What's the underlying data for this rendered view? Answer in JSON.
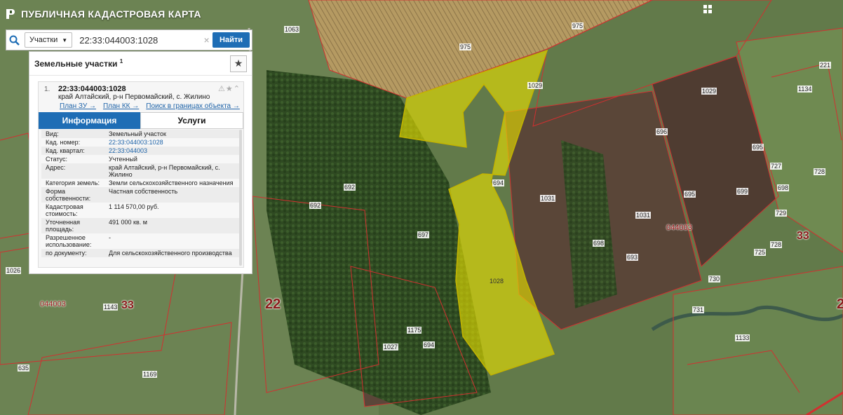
{
  "app": {
    "title": "ПУБЛИЧНАЯ КАДАСТРОВАЯ КАРТА"
  },
  "search": {
    "type_label": "Участки",
    "query": "22:33:044003:1028",
    "button_label": "Найти"
  },
  "results": {
    "title": "Земельные участки",
    "count": "1",
    "item": {
      "index": "1.",
      "cadastral_number": "22:33:044003:1028",
      "address": "край Алтайский, р-н Первомайский, с. Жилино",
      "links": [
        "План ЗУ →",
        "План КК →",
        "Поиск в границах объекта →"
      ],
      "tabs": [
        "Информация",
        "Услуги"
      ],
      "rows": [
        {
          "key": "Вид:",
          "value": "Земельный участок"
        },
        {
          "key": "Кад. номер:",
          "value": "22:33:044003:1028"
        },
        {
          "key": "Кад. квартал:",
          "value": "22:33:044003"
        },
        {
          "key": "Статус:",
          "value": "Учтенный"
        },
        {
          "key": "Адрес:",
          "value": "край Алтайский, р-н Первомайский, с. Жилино"
        },
        {
          "key": "Категория земель:",
          "value": "Земли сельскохозяйственного назначения"
        },
        {
          "key": "Форма собственности:",
          "value": "Частная собственность"
        },
        {
          "key": "Кадастровая стоимость:",
          "value": "1 114 570,00 руб."
        },
        {
          "key": "Уточненная площадь:",
          "value": "491 000 кв. м"
        },
        {
          "key": "Разрешенное использование:",
          "value": "-"
        },
        {
          "key": "по документу:",
          "value": "Для сельскохозяйственного производства"
        }
      ]
    }
  },
  "map": {
    "selected_parcel": "1028",
    "parcel_labels": [
      "1063",
      "975",
      "975",
      "1029",
      "1029",
      "1134",
      "221",
      "1031",
      "1031",
      "692",
      "692",
      "694",
      "698",
      "693",
      "1026",
      "1143",
      "1175",
      "694",
      "1027",
      "1169",
      "1133",
      "730",
      "731",
      "727",
      "729",
      "728",
      "725",
      "728",
      "696",
      "695",
      "698",
      "699",
      "635",
      "697",
      "695"
    ],
    "quarter_labels": [
      "044003",
      "044003"
    ],
    "district_labels": [
      "22",
      "33",
      "33",
      "2"
    ],
    "colors": {
      "boundary": "#d23030",
      "selection": "#e8e000",
      "accent": "#1e6db5"
    }
  }
}
